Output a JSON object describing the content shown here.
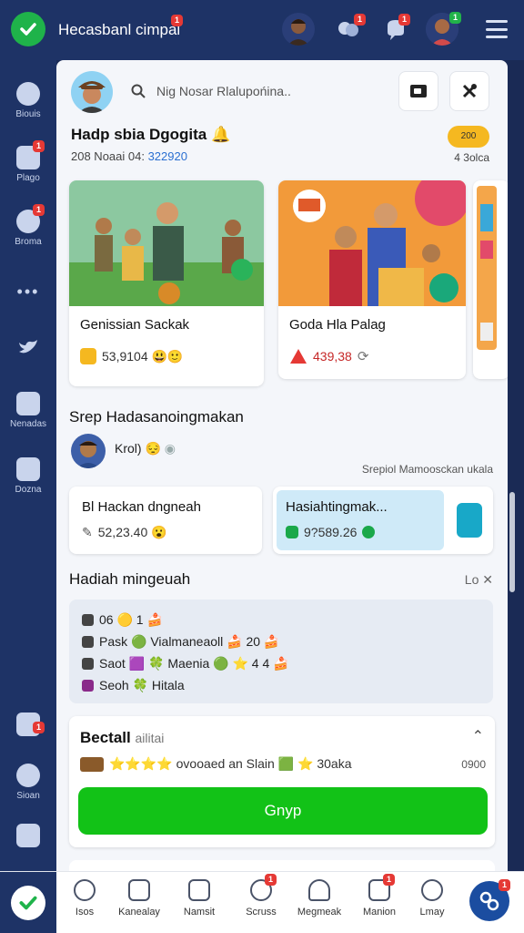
{
  "app": {
    "title": "Hecasbanl cimpal",
    "title_badge": "1"
  },
  "topbar": {
    "badges": {
      "chat": "1",
      "notify": "1",
      "profile": "1"
    }
  },
  "sidebar": {
    "items": [
      {
        "label": "Biouis",
        "icon": "chat-bubble-icon"
      },
      {
        "label": "Plago",
        "icon": "calendar-icon",
        "badge": "1"
      },
      {
        "label": "Broma",
        "icon": "message-icon",
        "badge": "1"
      },
      {
        "label": "",
        "icon": "more-icon"
      },
      {
        "label": "",
        "icon": "bird-icon"
      },
      {
        "label": "Nenadas",
        "icon": "grid-icon"
      },
      {
        "label": "Dozna",
        "icon": "puzzle-icon"
      },
      {
        "label": "",
        "icon": "board-icon",
        "badge": "1"
      },
      {
        "label": "Sioan",
        "icon": "group-icon"
      },
      {
        "label": "",
        "icon": "people-icon"
      }
    ]
  },
  "search": {
    "placeholder": "Nig Nosar Rlalupońina.."
  },
  "greeting": {
    "title": "Hadp sbia Dgogita 🔔",
    "sub_prefix": "208 Noaai 04:",
    "sub_accent": "322920",
    "pill": "200",
    "right": "4 3olca"
  },
  "cards": [
    {
      "title": "Genissian Sackak",
      "meta": "53,9104 😃🙂"
    },
    {
      "title": "Goda Hla Palag",
      "meta": "439,38"
    }
  ],
  "section1": {
    "title": "Srep Hadasanoingmakan",
    "row": "Krol) 😔",
    "right": "Srepiol Mamoosckan ukala"
  },
  "tasks": [
    {
      "title": "Bl Hackan dngneah",
      "value": "52,23.40 😮"
    },
    {
      "title": "Hasiahtingmak...",
      "value": "9?589.26"
    }
  ],
  "section2": {
    "title": "Hadiah mingeuah",
    "right": "Lo"
  },
  "list": [
    "06 🟡 1 🍰",
    "Pask 🟢 Vialmaneaoll 🍰 20 🍰",
    "Saot 🟪 🍀 Maenia 🟢 ⭐ 4 4 🍰",
    "Seoh 🍀 Hitala"
  ],
  "detail": {
    "title": "Bectall",
    "title_suffix": "ailitai",
    "line": "⭐⭐⭐⭐ ovooaed an Slain 🟩 ⭐ 30aka",
    "right": "0900",
    "cta": "Gnyp"
  },
  "bottom_nav": [
    {
      "label": "Isos",
      "icon": "smile-icon"
    },
    {
      "label": "Kanealay",
      "icon": "heart-icon"
    },
    {
      "label": "Namsit",
      "icon": "inbox-icon"
    },
    {
      "label": "Scruss",
      "icon": "search-icon",
      "badge": "1"
    },
    {
      "label": "Megmeak",
      "icon": "user-icon"
    },
    {
      "label": "Manion",
      "icon": "clipboard-icon",
      "badge": "1"
    },
    {
      "label": "Lmay",
      "icon": "chat-icon"
    }
  ],
  "bottom_fab_badge": "1",
  "colors": {
    "navy": "#1e3366",
    "green": "#12c217",
    "accent_blue": "#2a6fd1",
    "badge_red": "#e53935",
    "pill_yellow": "#f5b820"
  }
}
